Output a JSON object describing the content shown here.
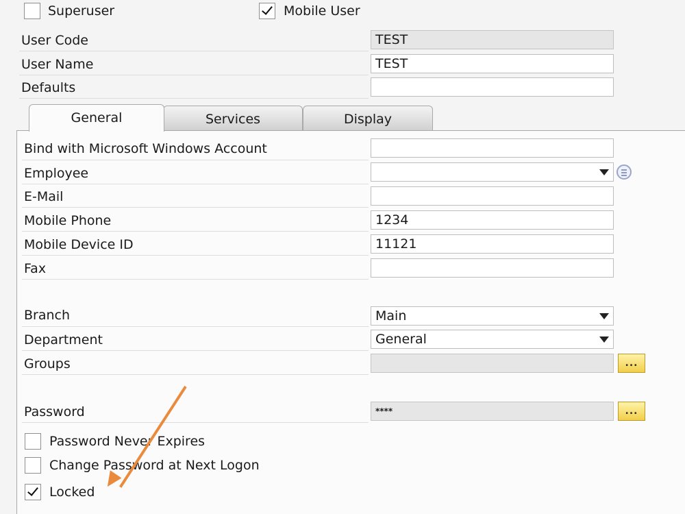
{
  "header": {
    "superuser": {
      "label": "Superuser",
      "checked": false
    },
    "mobile_user": {
      "label": "Mobile User",
      "checked": true
    },
    "user_code": {
      "label": "User Code",
      "value": "TEST"
    },
    "user_name": {
      "label": "User Name",
      "value": "TEST"
    },
    "defaults": {
      "label": "Defaults",
      "value": ""
    }
  },
  "tabs": [
    {
      "label": "General",
      "active": true
    },
    {
      "label": "Services",
      "active": false
    },
    {
      "label": "Display",
      "active": false
    }
  ],
  "general": {
    "bind_windows": {
      "label": "Bind with Microsoft Windows Account",
      "value": ""
    },
    "employee": {
      "label": "Employee",
      "value": ""
    },
    "email": {
      "label": "E-Mail",
      "value": ""
    },
    "mobile_phone": {
      "label": "Mobile Phone",
      "value": "1234"
    },
    "mobile_device_id": {
      "label": "Mobile Device ID",
      "value": "11121"
    },
    "fax": {
      "label": "Fax",
      "value": ""
    },
    "branch": {
      "label": "Branch",
      "value": "Main"
    },
    "department": {
      "label": "Department",
      "value": "General"
    },
    "groups": {
      "label": "Groups",
      "value": "",
      "button_label": "..."
    },
    "password": {
      "label": "Password",
      "value": "****",
      "button_label": "..."
    },
    "password_never_expires": {
      "label": "Password Never Expires",
      "checked": false
    },
    "change_password": {
      "label": "Change Password at Next Logon",
      "checked": false
    },
    "locked": {
      "label": "Locked",
      "checked": true
    }
  },
  "colors": {
    "annotation_arrow": "#ea8a3d",
    "lookup_button": "#f2cf4a"
  },
  "icons": {
    "employee_list": "list-icon",
    "dropdown": "chevron-down-icon",
    "checkmark": "checkmark-icon"
  }
}
